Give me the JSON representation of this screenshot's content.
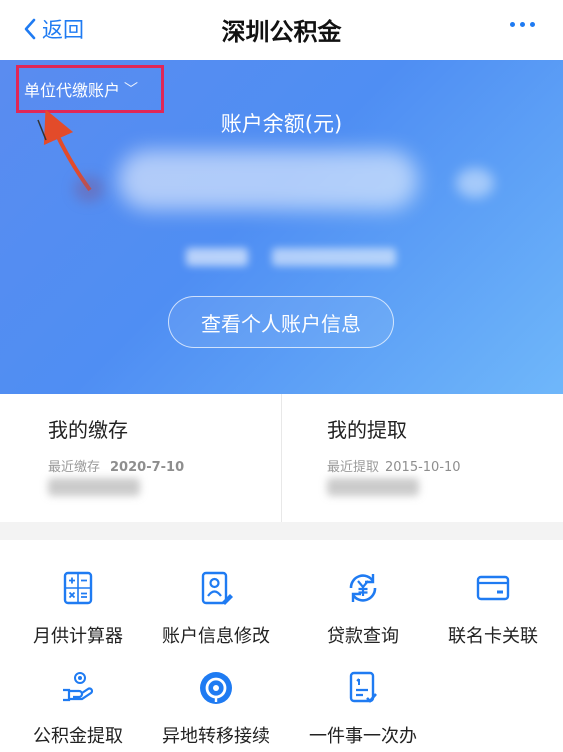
{
  "nav": {
    "back_label": "返回",
    "title": "深圳公积金"
  },
  "account": {
    "type_label": "单位代缴账户",
    "balance_label": "账户余额(元)",
    "view_button": "查看个人账户信息"
  },
  "deposit": {
    "title": "我的缴存",
    "recent_label": "最近缴存",
    "recent_date": "2020-7-10"
  },
  "withdraw": {
    "title": "我的提取",
    "recent_label": "最近提取",
    "recent_date": "2015-10-10"
  },
  "services": [
    {
      "label": "月供计算器",
      "icon": "calculator-icon"
    },
    {
      "label": "账户信息修改",
      "icon": "profile-edit-icon"
    },
    {
      "label": "贷款查询",
      "icon": "loan-yuan-icon"
    },
    {
      "label": "联名卡关联",
      "icon": "card-icon"
    },
    {
      "label": "公积金提取",
      "icon": "hand-coin-icon"
    },
    {
      "label": "异地转移接续",
      "icon": "location-transfer-icon"
    },
    {
      "label": "一件事一次办",
      "icon": "checklist-icon"
    }
  ],
  "colors": {
    "accent": "#1f7bf2",
    "highlight_box": "#e02757",
    "hero_start": "#5a8cf0",
    "hero_end": "#6fb7fa"
  }
}
